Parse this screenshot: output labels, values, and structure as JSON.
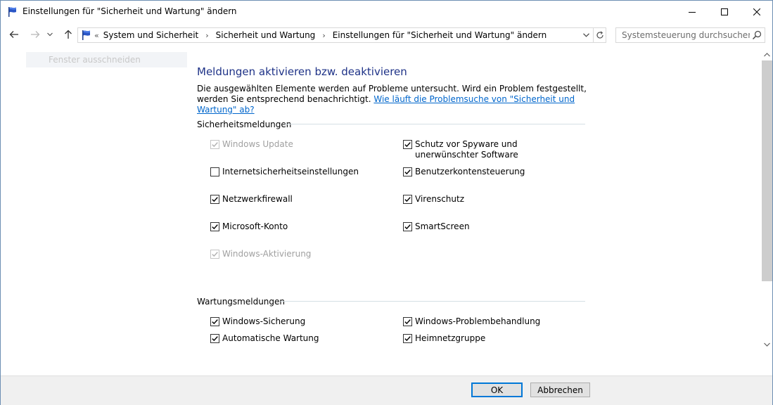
{
  "window": {
    "title": "Einstellungen für \"Sicherheit und Wartung\" ändern"
  },
  "address": {
    "overflow": "«",
    "crumbs": [
      "System und Sicherheit",
      "Sicherheit und Wartung",
      "Einstellungen für \"Sicherheit und Wartung\" ändern"
    ]
  },
  "search": {
    "placeholder": "Systemsteuerung durchsuchen",
    "value": ""
  },
  "left_pane": {
    "item": "Fenster ausschneiden"
  },
  "main": {
    "heading": "Meldungen aktivieren bzw. deaktivieren",
    "description": "Die ausgewählten Elemente werden auf Probleme untersucht. Wird ein Problem festgestellt, werden Sie entsprechend benachrichtigt.",
    "help_link": "Wie läuft die Problemsuche von \"Sicherheit und Wartung\" ab?",
    "security_section": {
      "title": "Sicherheitsmeldungen",
      "items": [
        {
          "label": "Windows Update",
          "checked": true,
          "disabled": true
        },
        {
          "label": "Schutz vor Spyware und unerwünschter Software",
          "checked": true,
          "disabled": false
        },
        {
          "label": "Internetsicherheitseinstellungen",
          "checked": false,
          "disabled": false
        },
        {
          "label": "Benutzerkontensteuerung",
          "checked": true,
          "disabled": false
        },
        {
          "label": "Netzwerkfirewall",
          "checked": true,
          "disabled": false
        },
        {
          "label": "Virenschutz",
          "checked": true,
          "disabled": false
        },
        {
          "label": "Microsoft-Konto",
          "checked": true,
          "disabled": false
        },
        {
          "label": "SmartScreen",
          "checked": true,
          "disabled": false
        },
        {
          "label": "Windows-Aktivierung",
          "checked": true,
          "disabled": true
        }
      ]
    },
    "maintenance_section": {
      "title": "Wartungsmeldungen",
      "items": [
        {
          "label": "Windows-Sicherung",
          "checked": true,
          "disabled": false
        },
        {
          "label": "Windows-Problembehandlung",
          "checked": true,
          "disabled": false
        },
        {
          "label": "Automatische Wartung",
          "checked": true,
          "disabled": false
        },
        {
          "label": "Heimnetzgruppe",
          "checked": true,
          "disabled": false
        }
      ]
    }
  },
  "footer": {
    "ok_label": "OK",
    "cancel_label": "Abbrechen"
  },
  "colors": {
    "heading": "#1e3287",
    "link": "#0066cc",
    "focus_border": "#0078d7"
  },
  "icons": {
    "app": "flag-icon",
    "back": "back-arrow-icon",
    "forward": "forward-arrow-icon",
    "recent": "chevron-down-icon",
    "up": "up-arrow-icon",
    "refresh": "refresh-icon",
    "search": "search-icon"
  }
}
